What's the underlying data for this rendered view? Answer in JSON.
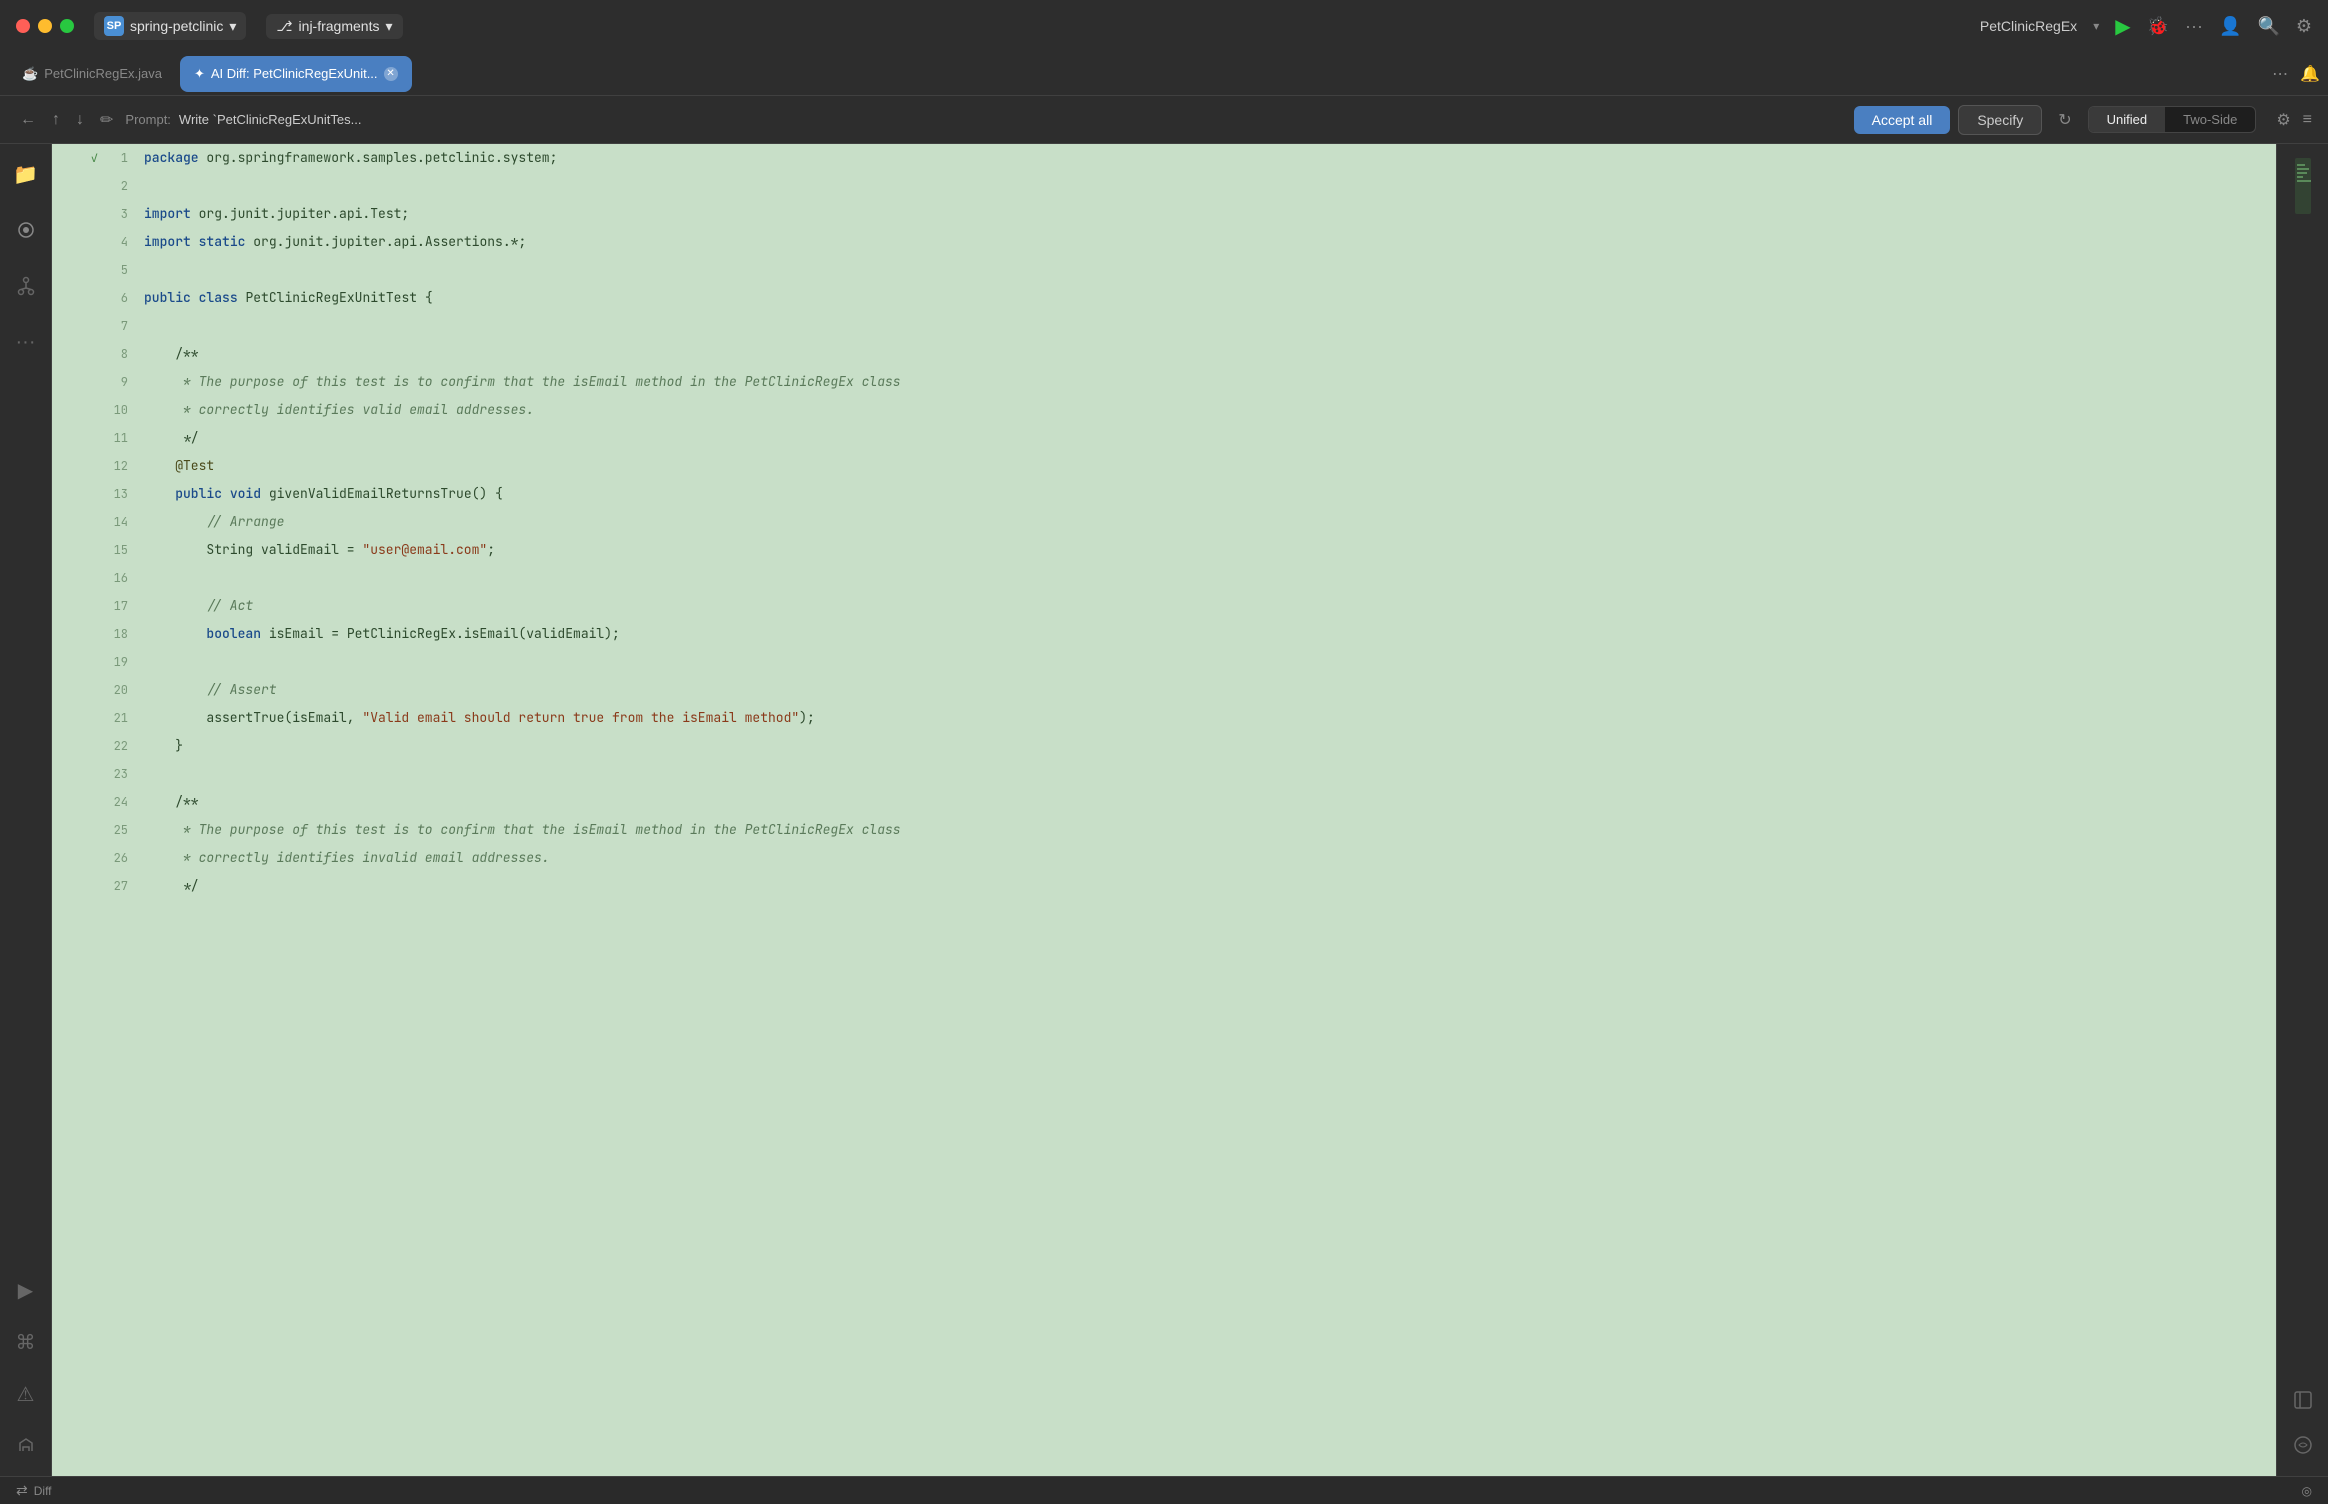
{
  "titleBar": {
    "trafficLights": [
      "red",
      "yellow",
      "green"
    ],
    "project": {
      "icon": "SP",
      "label": "spring-petclinic",
      "chevron": "▾"
    },
    "branch": {
      "icon": "⎇",
      "label": "inj-fragments",
      "chevron": "▾"
    },
    "runFile": "PetClinicRegEx",
    "chevron": "▾"
  },
  "tabs": [
    {
      "id": "petclinic-java",
      "icon": "☕",
      "label": "PetClinicRegEx.java",
      "active": false,
      "closable": false
    },
    {
      "id": "ai-diff",
      "icon": "✦",
      "label": "AI Diff: PetClinicRegExUnit...",
      "active": true,
      "closable": true
    }
  ],
  "toolbar": {
    "promptLabel": "Prompt:",
    "promptText": "Write `PetClinicRegExUnitTes...",
    "acceptAllLabel": "Accept all",
    "specifyLabel": "Specify",
    "refreshIcon": "↻",
    "unifiedLabel": "Unified",
    "twoSideLabel": "Two-Side"
  },
  "code": {
    "lines": [
      {
        "num": 1,
        "check": true,
        "content": [
          {
            "type": "kw",
            "text": "package"
          },
          {
            "type": "plain",
            "text": " org.springframework.samples.petclinic.system;"
          }
        ]
      },
      {
        "num": 2,
        "check": false,
        "content": []
      },
      {
        "num": 3,
        "check": false,
        "content": [
          {
            "type": "kw",
            "text": "import"
          },
          {
            "type": "plain",
            "text": " org.junit.jupiter.api.Test;"
          }
        ]
      },
      {
        "num": 4,
        "check": false,
        "content": [
          {
            "type": "kw",
            "text": "import"
          },
          {
            "type": "plain",
            "text": " "
          },
          {
            "type": "kw",
            "text": "static"
          },
          {
            "type": "plain",
            "text": " org.junit.jupiter.api.Assertions.*;"
          }
        ]
      },
      {
        "num": 5,
        "check": false,
        "content": []
      },
      {
        "num": 6,
        "check": false,
        "content": [
          {
            "type": "kw",
            "text": "public"
          },
          {
            "type": "plain",
            "text": " "
          },
          {
            "type": "kw",
            "text": "class"
          },
          {
            "type": "plain",
            "text": " PetClinicRegExUnitTest {"
          }
        ]
      },
      {
        "num": 7,
        "check": false,
        "content": []
      },
      {
        "num": 8,
        "check": false,
        "content": [
          {
            "type": "plain",
            "text": "    /**"
          }
        ]
      },
      {
        "num": 9,
        "check": false,
        "content": [
          {
            "type": "cmt",
            "text": "     * The purpose of this test is to confirm that the isEmail method in the PetClinicRegEx class"
          }
        ]
      },
      {
        "num": 10,
        "check": false,
        "content": [
          {
            "type": "cmt",
            "text": "     * correctly identifies valid email addresses."
          }
        ]
      },
      {
        "num": 11,
        "check": false,
        "content": [
          {
            "type": "plain",
            "text": "     */"
          }
        ]
      },
      {
        "num": 12,
        "check": false,
        "content": [
          {
            "type": "ann",
            "text": "    @Test"
          }
        ]
      },
      {
        "num": 13,
        "check": false,
        "content": [
          {
            "type": "plain",
            "text": "    "
          },
          {
            "type": "kw",
            "text": "public"
          },
          {
            "type": "plain",
            "text": " "
          },
          {
            "type": "kw",
            "text": "void"
          },
          {
            "type": "plain",
            "text": " givenValidEmailReturnsTrue() {"
          }
        ]
      },
      {
        "num": 14,
        "check": false,
        "content": [
          {
            "type": "cmt",
            "text": "        // Arrange"
          }
        ]
      },
      {
        "num": 15,
        "check": false,
        "content": [
          {
            "type": "plain",
            "text": "        String validEmail = "
          },
          {
            "type": "str",
            "text": "\"user@email.com\""
          },
          {
            "type": "plain",
            "text": ";"
          }
        ]
      },
      {
        "num": 16,
        "check": false,
        "content": []
      },
      {
        "num": 17,
        "check": false,
        "content": [
          {
            "type": "cmt",
            "text": "        // Act"
          }
        ]
      },
      {
        "num": 18,
        "check": false,
        "content": [
          {
            "type": "kw",
            "text": "        boolean"
          },
          {
            "type": "plain",
            "text": " isEmail = PetClinicRegEx.isEmail(validEmail);"
          }
        ]
      },
      {
        "num": 19,
        "check": false,
        "content": []
      },
      {
        "num": 20,
        "check": false,
        "content": [
          {
            "type": "cmt",
            "text": "        // Assert"
          }
        ]
      },
      {
        "num": 21,
        "check": false,
        "content": [
          {
            "type": "plain",
            "text": "        assertTrue(isEmail, "
          },
          {
            "type": "str",
            "text": "\"Valid email should return true from the isEmail method\""
          },
          {
            "type": "plain",
            "text": ");"
          }
        ]
      },
      {
        "num": 22,
        "check": false,
        "content": [
          {
            "type": "plain",
            "text": "    }"
          }
        ]
      },
      {
        "num": 23,
        "check": false,
        "content": []
      },
      {
        "num": 24,
        "check": false,
        "content": [
          {
            "type": "plain",
            "text": "    /**"
          }
        ]
      },
      {
        "num": 25,
        "check": false,
        "content": [
          {
            "type": "cmt",
            "text": "     * The purpose of this test is to confirm that the isEmail method in the PetClinicRegEx class"
          }
        ]
      },
      {
        "num": 26,
        "check": false,
        "content": [
          {
            "type": "cmt",
            "text": "     * correctly identifies invalid email addresses."
          }
        ]
      },
      {
        "num": 27,
        "check": false,
        "content": [
          {
            "type": "plain",
            "text": "     */"
          }
        ]
      }
    ]
  },
  "statusBar": {
    "diffLabel": "Diff",
    "rightIcon": "◎"
  }
}
